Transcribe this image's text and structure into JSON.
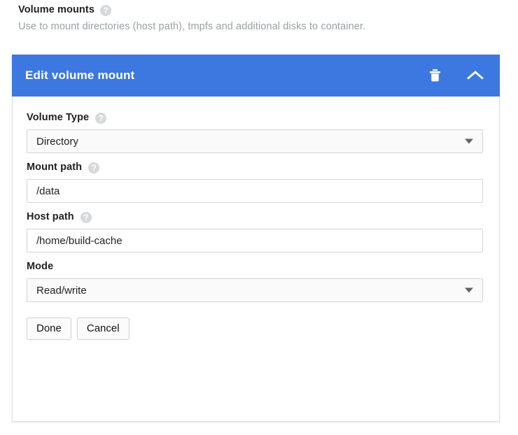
{
  "section": {
    "title": "Volume mounts",
    "help_icon": "help-circle-icon",
    "help_glyph": "?",
    "description": "Use to mount directories (host path), tmpfs and additional disks to container."
  },
  "card": {
    "header": {
      "title": "Edit volume mount",
      "background_color": "#3c78e0",
      "delete_icon": "trash-icon",
      "collapse_icon": "chevron-up-icon"
    },
    "fields": [
      {
        "name": "volume-type",
        "label": "Volume Type",
        "has_help": true,
        "control": "select",
        "value": "Directory",
        "options": [
          "Directory"
        ]
      },
      {
        "name": "mount-path",
        "label": "Mount path",
        "has_help": true,
        "control": "text",
        "value": "/data",
        "placeholder": ""
      },
      {
        "name": "host-path",
        "label": "Host path",
        "has_help": true,
        "control": "text",
        "value": "/home/build-cache",
        "placeholder": ""
      },
      {
        "name": "mode",
        "label": "Mode",
        "has_help": false,
        "control": "select",
        "value": "Read/write",
        "options": [
          "Read/write"
        ]
      }
    ],
    "buttons": {
      "done_label": "Done",
      "cancel_label": "Cancel"
    }
  }
}
